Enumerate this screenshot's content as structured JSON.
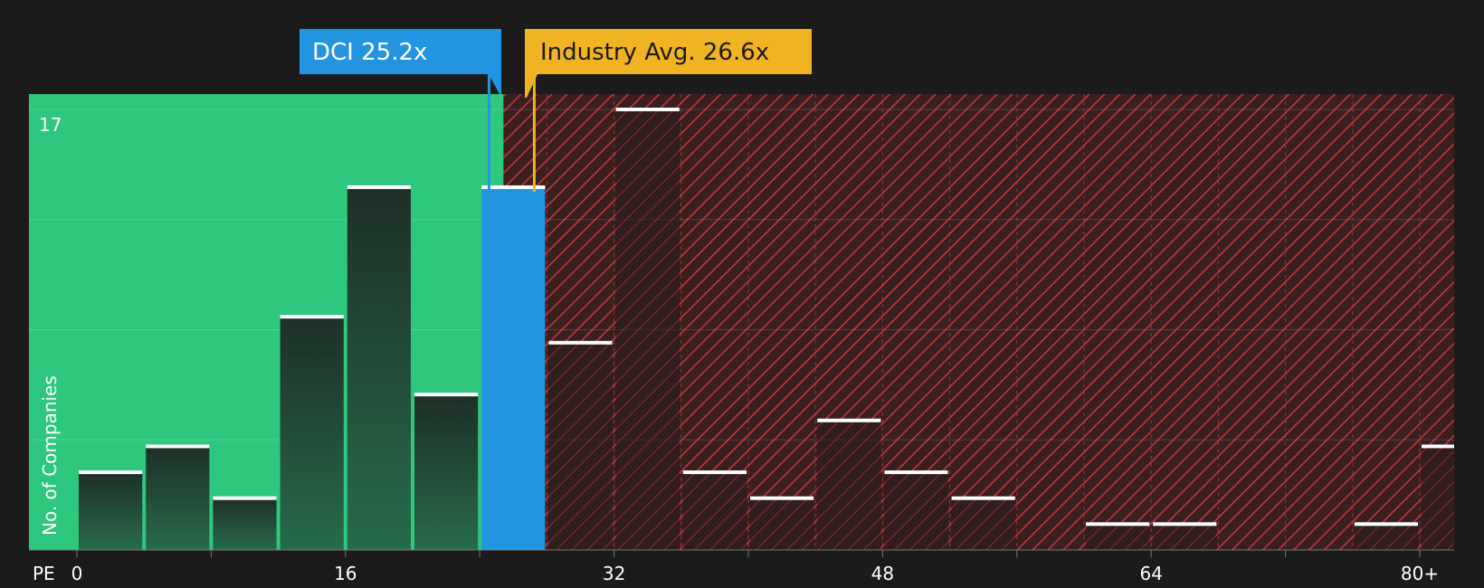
{
  "chart_data": {
    "type": "bar",
    "x_axis_label": "PE",
    "ylabel": "No. of Companies",
    "x_ticks": [
      "0",
      "16",
      "32",
      "48",
      "64",
      "80+"
    ],
    "y_tick_labels": [
      "17"
    ],
    "ylim": [
      0,
      17
    ],
    "bin_width": 4,
    "bins": [
      {
        "start": 0,
        "count": 3
      },
      {
        "start": 4,
        "count": 4
      },
      {
        "start": 8,
        "count": 2
      },
      {
        "start": 12,
        "count": 9
      },
      {
        "start": 16,
        "count": 14
      },
      {
        "start": 20,
        "count": 6
      },
      {
        "start": 24,
        "count": 14
      },
      {
        "start": 28,
        "count": 8
      },
      {
        "start": 32,
        "count": 17
      },
      {
        "start": 36,
        "count": 3
      },
      {
        "start": 40,
        "count": 2
      },
      {
        "start": 44,
        "count": 5
      },
      {
        "start": 48,
        "count": 3
      },
      {
        "start": 52,
        "count": 2
      },
      {
        "start": 56,
        "count": 0
      },
      {
        "start": 60,
        "count": 1
      },
      {
        "start": 64,
        "count": 1
      },
      {
        "start": 68,
        "count": 0
      },
      {
        "start": 72,
        "count": 0
      },
      {
        "start": 76,
        "count": 1
      },
      {
        "start": 80,
        "count": 4
      }
    ],
    "highlight_bin_start": 24,
    "company": {
      "label": "DCI 25.2x",
      "value": 25.2,
      "color": "#2394e0"
    },
    "industry": {
      "label": "Industry Avg. 26.6x",
      "value": 26.6,
      "color": "#f0b323"
    },
    "colors": {
      "background": "#1b1b1b",
      "undervalued_zone": "#2ec77e",
      "overvalued_zone": "#3a1f1f",
      "hatch": "#c9393a",
      "bar_fill": "#1f3d31",
      "bar_cap": "#ffffff"
    }
  }
}
